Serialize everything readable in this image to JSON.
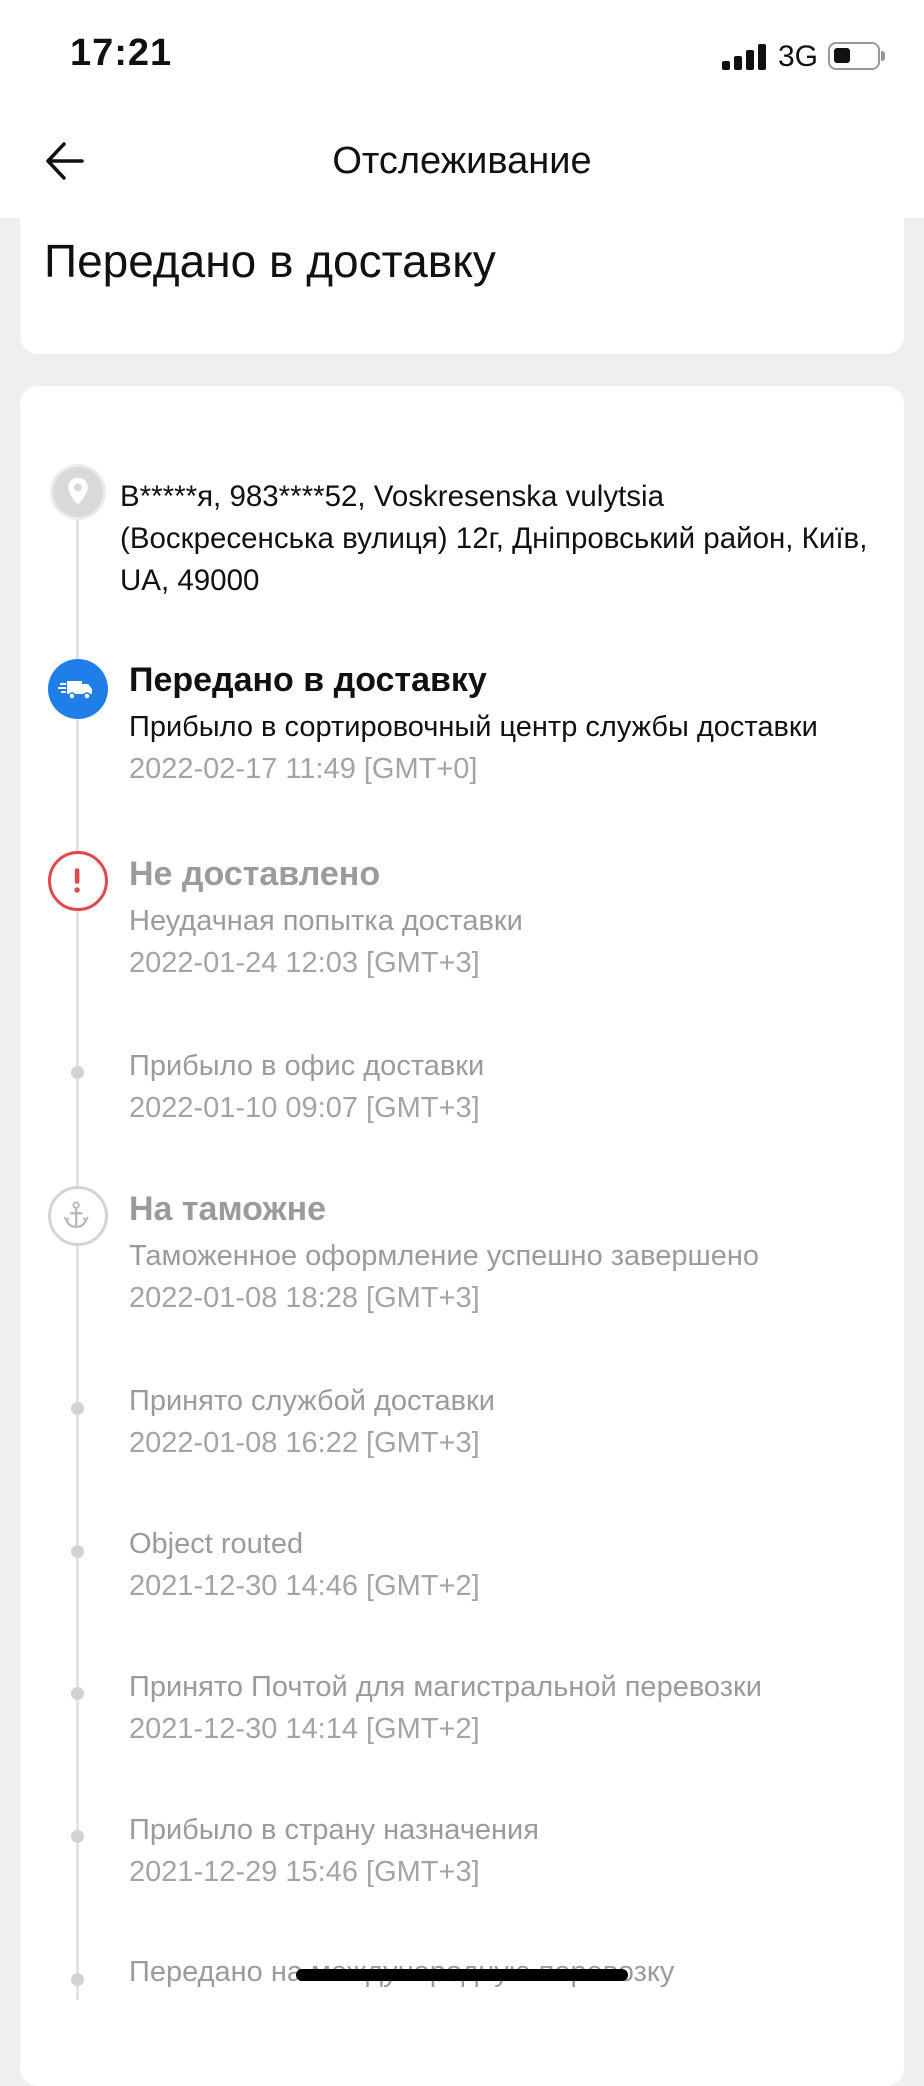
{
  "status_bar": {
    "time": "17:21",
    "network": "3G",
    "battery_level_fraction": 0.4
  },
  "header": {
    "title": "Отслеживание",
    "back_icon": "arrow-left-icon"
  },
  "summary": {
    "status": "Передано в доставку"
  },
  "address": {
    "icon": "location-pin-icon",
    "text": "В*****я,  983****52,  Voskresenska vulytsia (Воскресенська вулиця) 12г,  Дніпровський район,  Київ,  UA,  49000"
  },
  "events": [
    {
      "title": "Передано в доставку",
      "description": "Прибыло в сортировочный центр службы доставки",
      "time": "2022-02-17 11:49 [GMT+0]",
      "icon": "delivery-truck-icon",
      "active": true
    },
    {
      "title": "Не доставлено",
      "description": "Неудачная попытка доставки",
      "time": "2022-01-24 12:03 [GMT+3]",
      "icon": "alert-icon",
      "active": false
    },
    {
      "title": "",
      "description": "Прибыло в офис доставки",
      "time": "2022-01-10 09:07 [GMT+3]",
      "icon": "dot-icon",
      "active": false
    },
    {
      "title": "На таможне",
      "description": "Таможенное оформление успешно завершено",
      "time": "2022-01-08 18:28 [GMT+3]",
      "icon": "anchor-icon",
      "active": false
    },
    {
      "title": "",
      "description": "Принято службой доставки",
      "time": "2022-01-08 16:22 [GMT+3]",
      "icon": "dot-icon",
      "active": false
    },
    {
      "title": "",
      "description": "Object routed",
      "time": "2021-12-30 14:46 [GMT+2]",
      "icon": "dot-icon",
      "active": false
    },
    {
      "title": "",
      "description": "Принято Почтой для магистральной перевозки",
      "time": "2021-12-30 14:14 [GMT+2]",
      "icon": "dot-icon",
      "active": false
    },
    {
      "title": "",
      "description": "Прибыло в страну назначения",
      "time": "2021-12-29 15:46 [GMT+3]",
      "icon": "dot-icon",
      "active": false
    },
    {
      "title": "",
      "description": "Передано на международную перевозку",
      "time": "",
      "icon": "dot-icon",
      "active": false
    }
  ],
  "colors": {
    "accent": "#1f7ee8",
    "alert": "#e2474a",
    "muted_text": "#9b9b9b",
    "background": "#efefef"
  }
}
